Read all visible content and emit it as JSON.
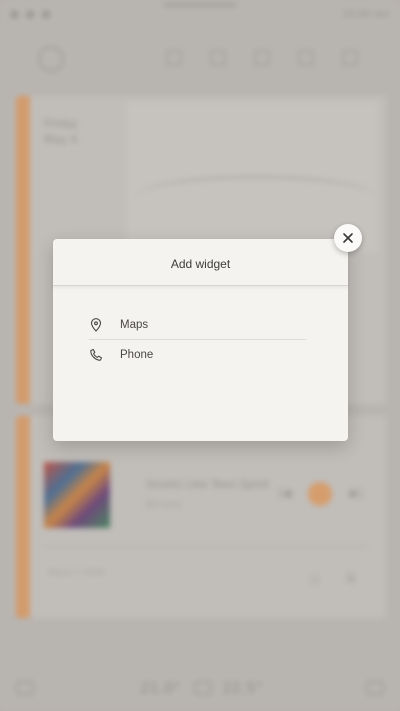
{
  "status_bar": {
    "carrier": "● ● ●",
    "time": "10:00 am"
  },
  "weather": {
    "day": "Friday",
    "date": "May 4"
  },
  "music": {
    "song": "Smells Like Teen Spirit",
    "artist": "Nirvana",
    "footer": "Album • 2019"
  },
  "climate": {
    "left_temp": "21.0°",
    "right_temp": "22.5°"
  },
  "dialog": {
    "title": "Add widget",
    "options": [
      {
        "label": "Maps",
        "icon": "map-pin-icon"
      },
      {
        "label": "Phone",
        "icon": "phone-icon"
      }
    ]
  },
  "colors": {
    "accent": "#e0985a",
    "dialog_bg": "#f5f3f0",
    "backdrop": "#b9b5b1"
  }
}
